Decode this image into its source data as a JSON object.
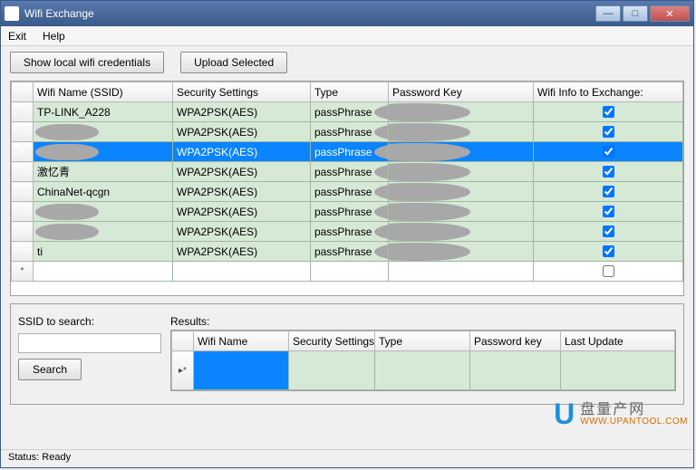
{
  "window": {
    "title": "Wifi Exchange"
  },
  "menu": {
    "exit": "Exit",
    "help": "Help"
  },
  "buttons": {
    "show_creds": "Show local wifi credentials",
    "upload": "Upload Selected",
    "search": "Search"
  },
  "grid": {
    "headers": {
      "ssid": "Wifi Name (SSID)",
      "security": "Security Settings",
      "type": "Type",
      "password": "Password Key",
      "exchange": "Wifi Info to Exchange:"
    },
    "rows": [
      {
        "ssid": "TP-LINK_A228",
        "security": "WPA2PSK(AES)",
        "type": "passPhrase",
        "checked": true,
        "selected": false,
        "blob_ssid": false
      },
      {
        "ssid": "",
        "security": "WPA2PSK(AES)",
        "type": "passPhrase",
        "checked": true,
        "selected": false,
        "blob_ssid": true
      },
      {
        "ssid": "",
        "security": "WPA2PSK(AES)",
        "type": "passPhrase",
        "checked": true,
        "selected": true,
        "blob_ssid": true
      },
      {
        "ssid": "激忆青",
        "security": "WPA2PSK(AES)",
        "type": "passPhrase",
        "checked": true,
        "selected": false,
        "blob_ssid": false
      },
      {
        "ssid": "ChinaNet-qcgn",
        "security": "WPA2PSK(AES)",
        "type": "passPhrase",
        "checked": true,
        "selected": false,
        "blob_ssid": false
      },
      {
        "ssid": "",
        "security": "WPA2PSK(AES)",
        "type": "passPhrase",
        "checked": true,
        "selected": false,
        "blob_ssid": true
      },
      {
        "ssid": "",
        "security": "WPA2PSK(AES)",
        "type": "passPhrase",
        "checked": true,
        "selected": false,
        "blob_ssid": true
      },
      {
        "ssid": "ti",
        "security": "WPA2PSK(AES)",
        "type": "passPhrase",
        "checked": true,
        "selected": false,
        "blob_ssid": false
      }
    ]
  },
  "search": {
    "label": "SSID to search:",
    "placeholder": ""
  },
  "results": {
    "label": "Results:",
    "headers": {
      "ssid": "Wifi Name",
      "security": "Security Settings",
      "type": "Type",
      "password": "Password key",
      "updated": "Last Update"
    }
  },
  "status": "Status: Ready",
  "watermark": {
    "cn": "盘量产网",
    "url": "WWW.UPANTOOL.COM"
  }
}
